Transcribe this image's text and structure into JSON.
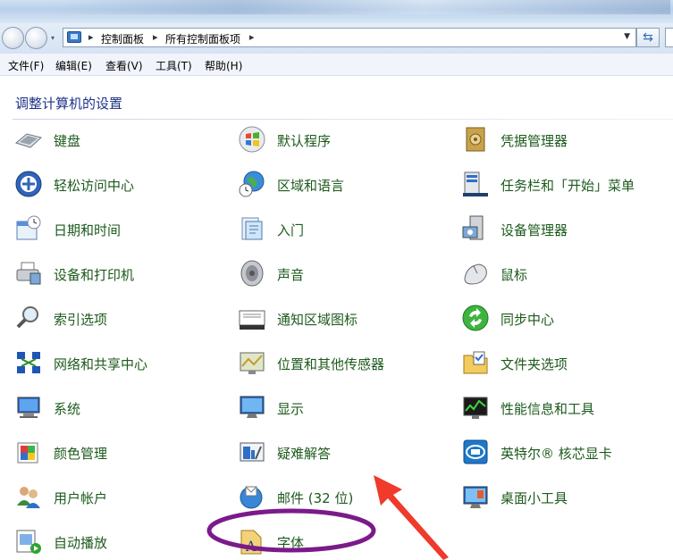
{
  "address_bar": {
    "crumbs": [
      "控制面板",
      "所有控制面板项"
    ]
  },
  "menu": [
    "文件(F)",
    "编辑(E)",
    "查看(V)",
    "工具(T)",
    "帮助(H)"
  ],
  "heading": "调整计算机的设置",
  "columns": [
    {
      "items": [
        {
          "label": "键盘",
          "icon": "keyboard-icon"
        },
        {
          "label": "轻松访问中心",
          "icon": "ease-of-access-icon"
        },
        {
          "label": "日期和时间",
          "icon": "calendar-clock-icon"
        },
        {
          "label": "设备和打印机",
          "icon": "printer-icon"
        },
        {
          "label": "索引选项",
          "icon": "magnifier-icon"
        },
        {
          "label": "网络和共享中心",
          "icon": "network-icon"
        },
        {
          "label": "系统",
          "icon": "computer-icon"
        },
        {
          "label": "颜色管理",
          "icon": "color-management-icon"
        },
        {
          "label": "用户帐户",
          "icon": "users-icon"
        },
        {
          "label": "自动播放",
          "icon": "autoplay-icon"
        }
      ]
    },
    {
      "items": [
        {
          "label": "默认程序",
          "icon": "windows-logo-icon"
        },
        {
          "label": "区域和语言",
          "icon": "globe-clock-icon"
        },
        {
          "label": "入门",
          "icon": "getting-started-icon"
        },
        {
          "label": "声音",
          "icon": "speaker-icon"
        },
        {
          "label": "通知区域图标",
          "icon": "notification-tray-icon"
        },
        {
          "label": "位置和其他传感器",
          "icon": "location-sensor-icon"
        },
        {
          "label": "显示",
          "icon": "display-icon"
        },
        {
          "label": "疑难解答",
          "icon": "troubleshooting-icon"
        },
        {
          "label": "邮件 (32 位)",
          "icon": "mail-icon"
        },
        {
          "label": "字体",
          "icon": "font-icon"
        }
      ]
    },
    {
      "items": [
        {
          "label": "凭据管理器",
          "icon": "vault-icon"
        },
        {
          "label": "任务栏和「开始」菜单",
          "icon": "taskbar-icon"
        },
        {
          "label": "设备管理器",
          "icon": "device-manager-icon"
        },
        {
          "label": "鼠标",
          "icon": "mouse-icon"
        },
        {
          "label": "同步中心",
          "icon": "sync-icon"
        },
        {
          "label": "文件夹选项",
          "icon": "folder-options-icon"
        },
        {
          "label": "性能信息和工具",
          "icon": "performance-icon"
        },
        {
          "label": "英特尔® 核芯显卡",
          "icon": "intel-graphics-icon"
        },
        {
          "label": "桌面小工具",
          "icon": "gadgets-icon"
        }
      ]
    }
  ],
  "annotation": {
    "color": "#7b1a8a",
    "arrow_color": "#ef3a2c",
    "highlighted": "疑难解答"
  }
}
